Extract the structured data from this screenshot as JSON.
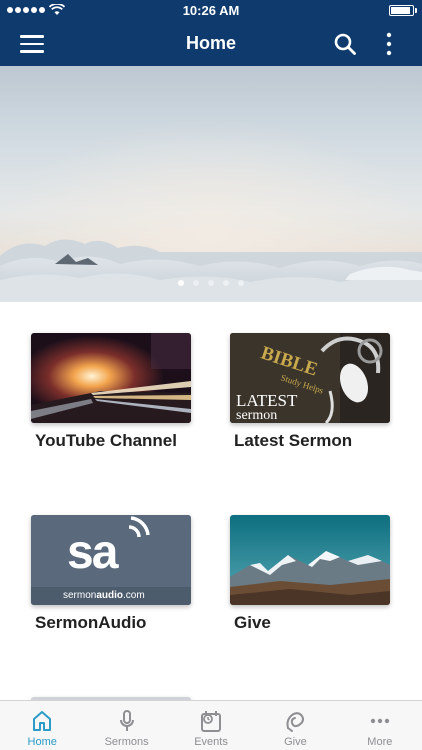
{
  "status_bar": {
    "time": "10:26 AM"
  },
  "nav": {
    "title": "Home"
  },
  "hero": {
    "pages": 5,
    "active_page": 1
  },
  "tiles": [
    {
      "label": "YouTube Channel"
    },
    {
      "label": "Latest Sermon",
      "image_text_top": "BIBLE",
      "image_text_mid": "Study Helps",
      "image_text_latest": "LATEST",
      "image_text_sermon": "sermon"
    },
    {
      "label": "SermonAudio",
      "image_logo": "sa",
      "image_caption_a": "sermon",
      "image_caption_b": "audio",
      "image_caption_c": ".com"
    },
    {
      "label": "Give"
    }
  ],
  "tabs": [
    {
      "label": "Home",
      "icon": "home-icon",
      "active": true
    },
    {
      "label": "Sermons",
      "icon": "microphone-icon",
      "active": false
    },
    {
      "label": "Events",
      "icon": "calendar-clock-icon",
      "active": false
    },
    {
      "label": "Give",
      "icon": "give-icon",
      "active": false
    },
    {
      "label": "More",
      "icon": "more-horizontal-icon",
      "active": false
    }
  ],
  "colors": {
    "brand": "#0f3a6e",
    "active_tab": "#2b9bc8",
    "inactive_tab": "#8e8e93"
  }
}
